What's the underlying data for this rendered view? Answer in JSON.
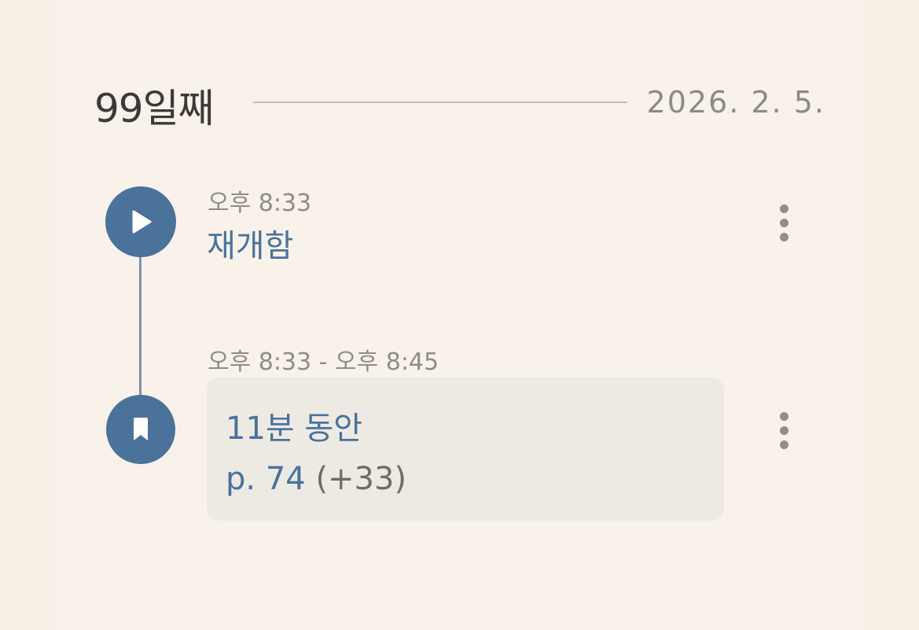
{
  "header": {
    "day_title": "99일째",
    "date": "2026. 2. 5."
  },
  "entries": [
    {
      "type": "resume",
      "icon": "play-icon",
      "time": "오후 8:33",
      "label": "재개함",
      "menu_icon": "more-vertical-icon"
    },
    {
      "type": "reading-session",
      "icon": "bookmark-icon",
      "time": "오후 8:33 - 오후 8:45",
      "duration": "11분 동안",
      "page": "p. 74",
      "page_delta": "(+33)",
      "menu_icon": "more-vertical-icon"
    }
  ],
  "colors": {
    "accent": "#4a729a",
    "background": "#f6efe6",
    "card": "#f8f2ea",
    "session_box": "#edeae4",
    "muted_text": "#8f8c88",
    "title_text": "#3a3a3a"
  }
}
